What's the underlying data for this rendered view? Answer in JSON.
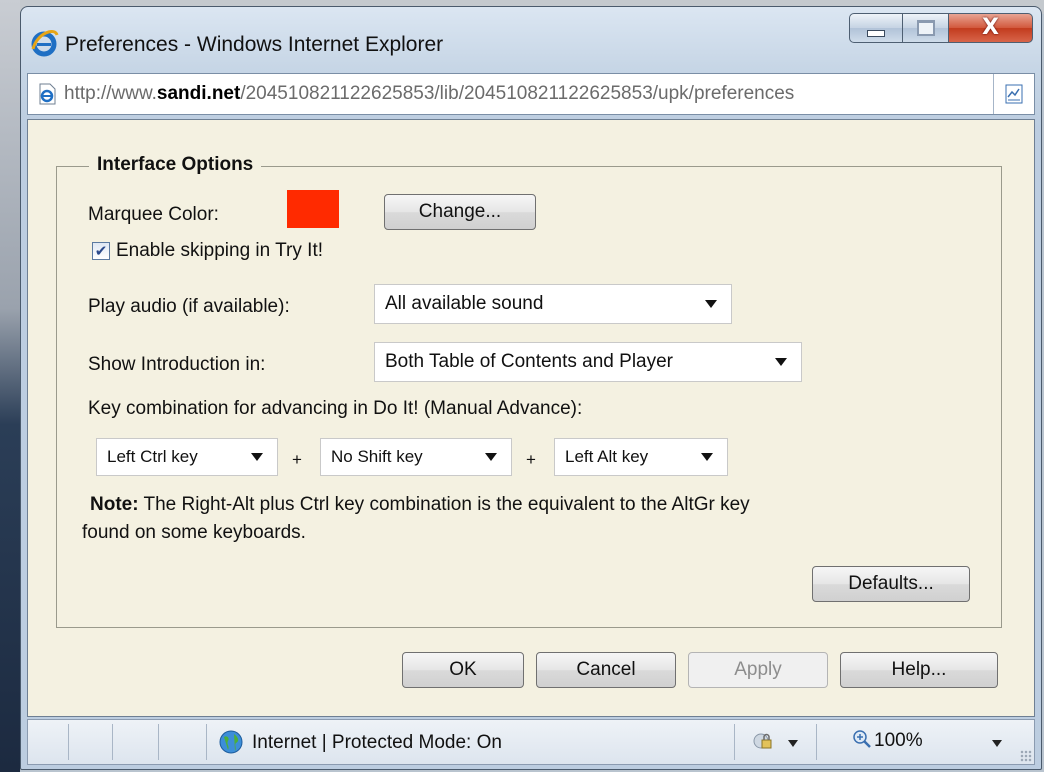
{
  "window": {
    "title": "Preferences - Windows Internet Explorer",
    "url_prefix": "http://www.",
    "url_domain": "sandi.net",
    "url_rest": "/204510821122625853/lib/204510821122625853/upk/preferences",
    "close_glyph": "X"
  },
  "dialog": {
    "section_title": "Interface Options",
    "marquee_label": "Marquee Color:",
    "marquee_color": "#ff2a00",
    "change_button": "Change...",
    "skip_checkbox_label": "Enable skipping in Try It!",
    "skip_checked": true,
    "audio_label": "Play audio (if available):",
    "audio_value": "All available sound",
    "intro_label": "Show Introduction in:",
    "intro_value": "Both Table of Contents and Player",
    "keycombo_label": "Key combination for advancing in Do It! (Manual Advance):",
    "key1_value": "Left Ctrl key",
    "key2_value": "No Shift key",
    "key3_value": "Left Alt key",
    "plus_sign": "+",
    "note_bold": "Note:",
    "note_line1": "The Right-Alt plus Ctrl key combination is the equivalent to the AltGr key",
    "note_line2": "found on some keyboards.",
    "defaults_button": "Defaults..."
  },
  "buttons": {
    "ok": "OK",
    "cancel": "Cancel",
    "apply": "Apply",
    "help": "Help..."
  },
  "statusbar": {
    "zone_text": "Internet | Protected Mode: On",
    "zoom": "100%"
  },
  "colors": {
    "content_bg": "#f4f1e1",
    "title_accent": "#c23b1e"
  }
}
